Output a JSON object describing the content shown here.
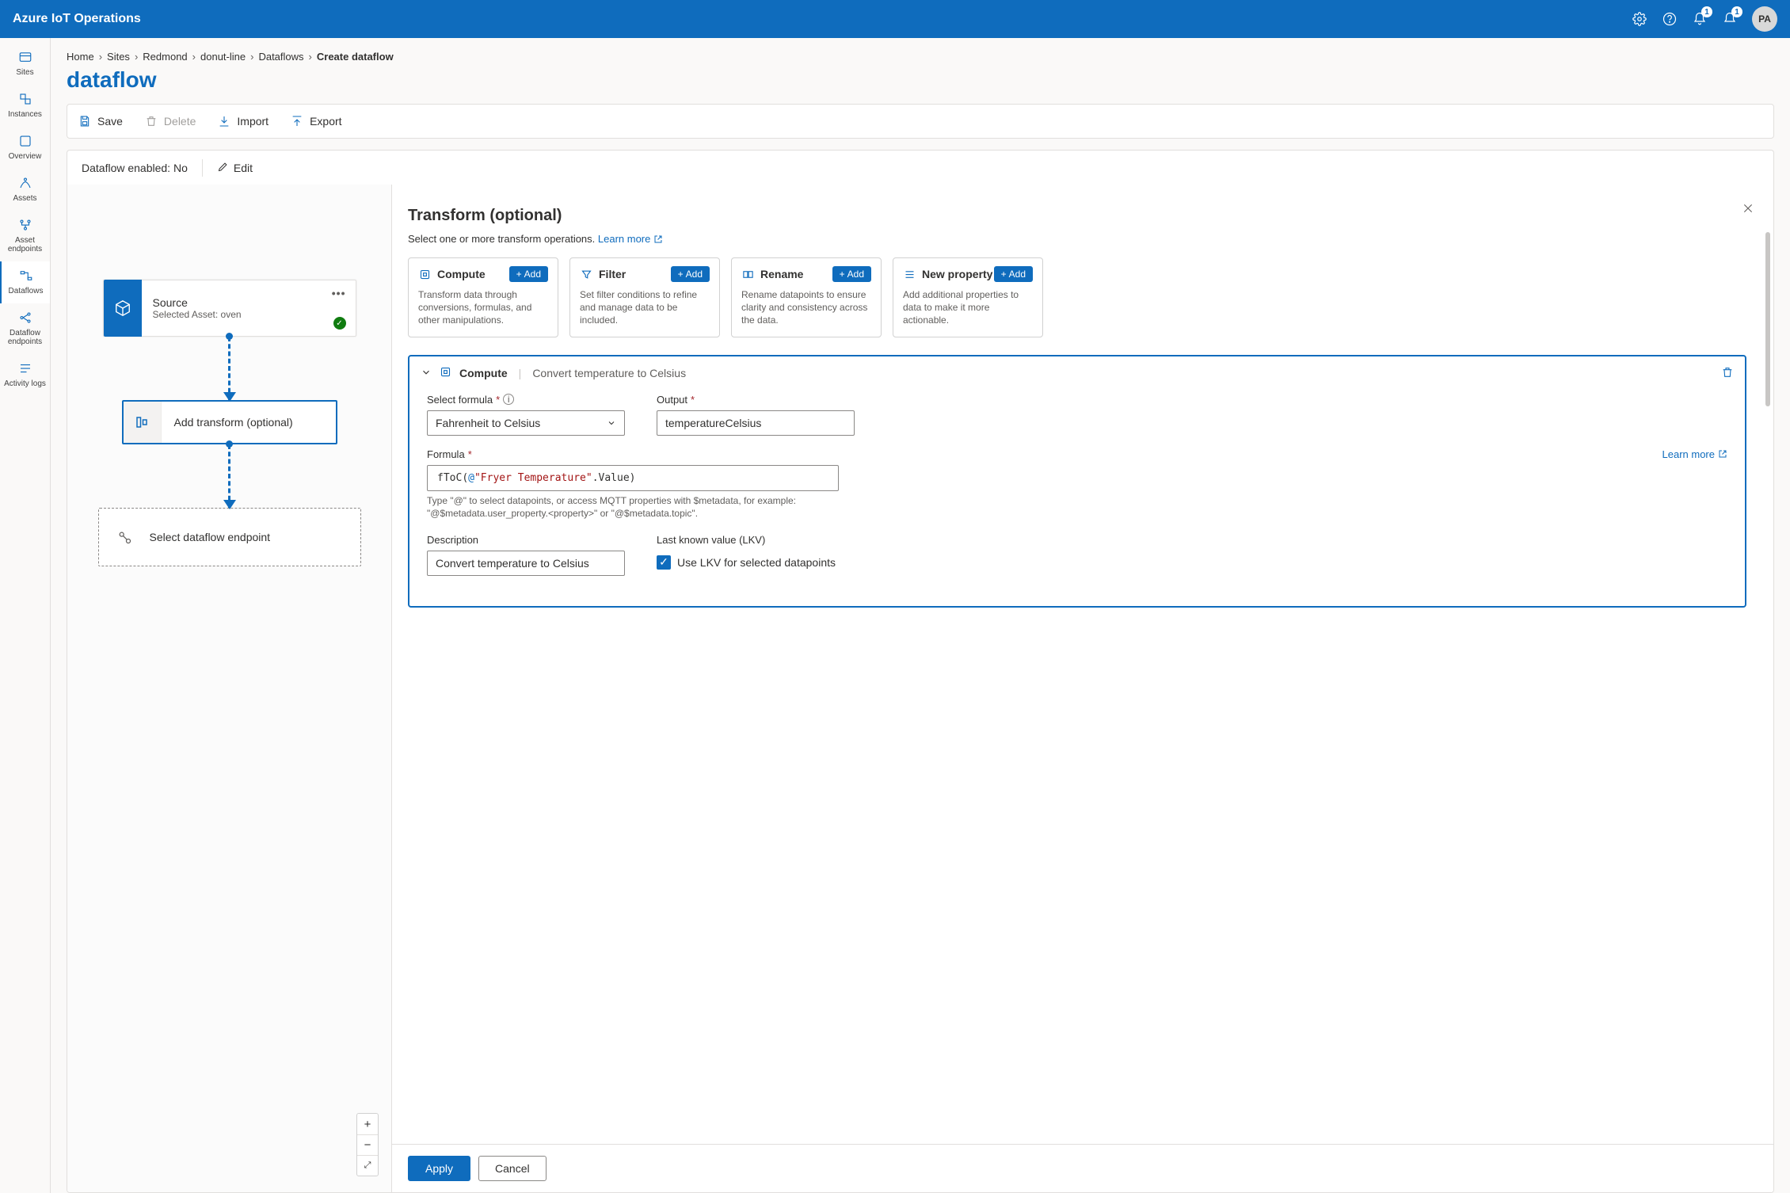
{
  "header": {
    "title": "Azure IoT Operations",
    "notification_badge": "1",
    "alert_badge": "1",
    "avatar_initials": "PA"
  },
  "leftnav": {
    "sites": "Sites",
    "instances": "Instances",
    "overview": "Overview",
    "assets": "Assets",
    "asset_endpoints": "Asset endpoints",
    "dataflows": "Dataflows",
    "dataflow_endpoints": "Dataflow endpoints",
    "activity_logs": "Activity logs"
  },
  "breadcrumb": {
    "home": "Home",
    "sites": "Sites",
    "site": "Redmond",
    "instance": "donut-line",
    "dataflows": "Dataflows",
    "current": "Create dataflow"
  },
  "page": {
    "title": "dataflow",
    "enabled_label": "Dataflow enabled: No",
    "edit": "Edit"
  },
  "toolbar": {
    "save": "Save",
    "delete": "Delete",
    "import": "Import",
    "export": "Export"
  },
  "canvas": {
    "source_title": "Source",
    "source_subtitle": "Selected Asset: oven",
    "transform_label": "Add transform (optional)",
    "endpoint_label": "Select dataflow endpoint"
  },
  "panel": {
    "title": "Transform (optional)",
    "subtitle_pre": "Select one or more transform operations. ",
    "learn_more": "Learn more",
    "cards": {
      "compute": {
        "title": "Compute",
        "add": "Add",
        "desc": "Transform data through conversions, formulas, and other manipulations."
      },
      "filter": {
        "title": "Filter",
        "add": "Add",
        "desc": "Set filter conditions to refine and manage data to be included."
      },
      "rename": {
        "title": "Rename",
        "add": "Add",
        "desc": "Rename datapoints to ensure clarity and consistency across the data."
      },
      "newprop": {
        "title": "New property",
        "add": "Add",
        "desc": "Add additional properties to data to make it more actionable."
      }
    },
    "compute": {
      "badge": "Compute",
      "subtitle": "Convert temperature to Celsius",
      "select_formula_label": "Select formula",
      "select_formula_value": "Fahrenheit to Celsius",
      "output_label": "Output",
      "output_value": "temperatureCelsius",
      "formula_label": "Formula",
      "formula_learn": "Learn more",
      "formula_fn": "fToC",
      "formula_at": "@",
      "formula_str": "\"Fryer Temperature\"",
      "formula_tail": ".Value",
      "formula_hint": "Type \"@\" to select datapoints, or access MQTT properties with $metadata, for example: \"@$metadata.user_property.<property>\" or \"@$metadata.topic\".",
      "description_label": "Description",
      "description_value": "Convert temperature to Celsius",
      "lkv_label": "Last known value (LKV)",
      "lkv_check": "Use LKV for selected datapoints"
    },
    "footer": {
      "apply": "Apply",
      "cancel": "Cancel"
    }
  }
}
